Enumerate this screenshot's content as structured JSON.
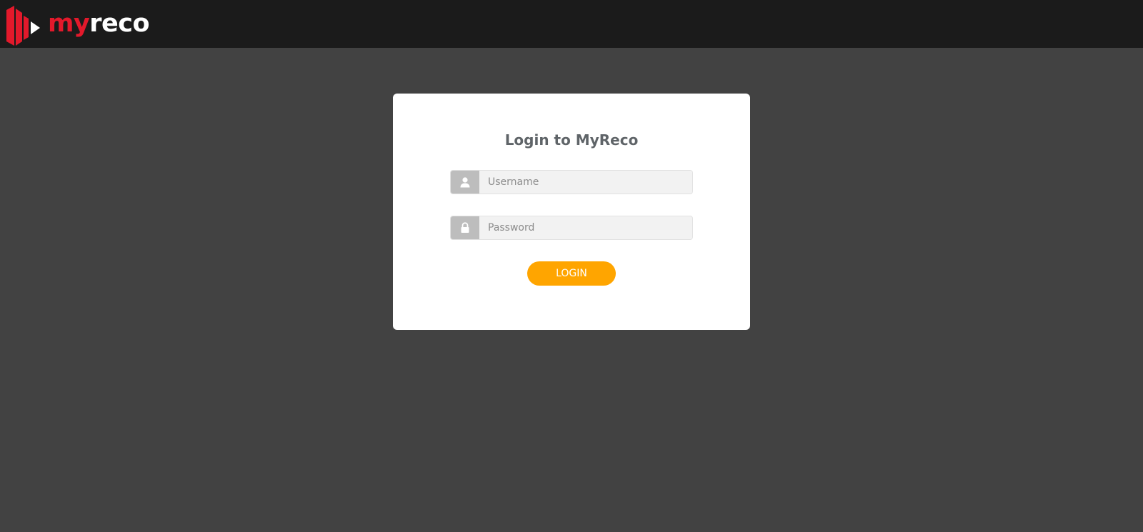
{
  "header": {
    "logo": {
      "part1": "my",
      "part2": "reco",
      "icon": "myreco-logo-icon"
    }
  },
  "login": {
    "title": "Login to MyReco",
    "username": {
      "placeholder": "Username",
      "value": "",
      "icon": "user-icon"
    },
    "password": {
      "placeholder": "Password",
      "value": "",
      "icon": "lock-icon"
    },
    "button_label": "LOGIN"
  },
  "colors": {
    "topbar": "#1b1b1b",
    "background": "#424242",
    "card": "#ffffff",
    "brand_red": "#e3192b",
    "accent": "#ffa500",
    "icon_bg": "#bdbdbd",
    "input_bg": "#f2f2f2",
    "title": "#5f6468"
  }
}
